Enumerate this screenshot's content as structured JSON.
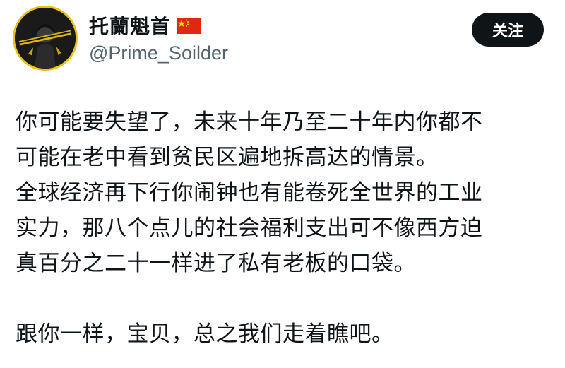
{
  "author": {
    "display_name": "托蘭魁首",
    "flag_icon": "china-flag-icon",
    "handle": "@Prime_Soilder",
    "avatar_icon": "avatar-icon"
  },
  "actions": {
    "follow_label": "关注"
  },
  "post": {
    "lines": [
      "你可能要失望了，未来十年乃至二十年内你都不",
      "可能在老中看到贫民区遍地拆高达的情景。",
      "全球经济再下行你闹钟也有能卷死全世界的工业",
      "实力，那八个点儿的社会福利支出可不像西方迫",
      "真百分之二十一样进了私有老板的口袋。",
      "",
      "跟你一样，宝贝，总之我们走着瞧吧。"
    ]
  },
  "colors": {
    "text": "#0f1419",
    "secondary": "#536471",
    "button_bg": "#0f1419",
    "avatar_ring": "#e8c21a",
    "flag_red": "#de2910",
    "flag_star": "#ffde00"
  }
}
